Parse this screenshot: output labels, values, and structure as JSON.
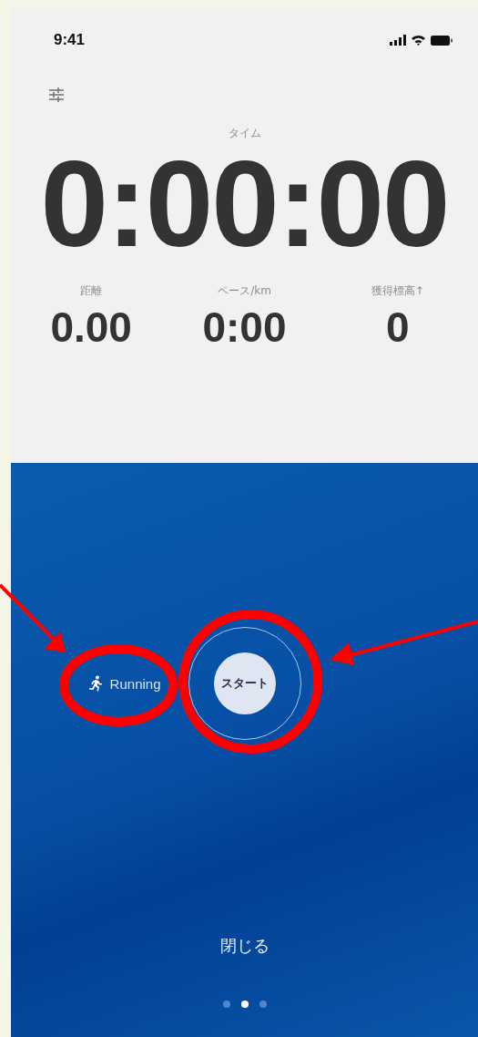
{
  "status_bar": {
    "time": "9:41"
  },
  "timer": {
    "label": "タイム",
    "value": "0:00:00"
  },
  "stats": [
    {
      "label": "距離",
      "value": "0.00"
    },
    {
      "label": "ペース/km",
      "value": "0:00"
    },
    {
      "label": "獲得標高↑",
      "value": "0"
    }
  ],
  "activity": {
    "label": "Running"
  },
  "start_button": {
    "label": "スタート"
  },
  "close_button": {
    "label": "閉じる"
  },
  "page_dots": [
    {
      "selected": false
    },
    {
      "selected": true
    },
    {
      "selected": false
    }
  ]
}
